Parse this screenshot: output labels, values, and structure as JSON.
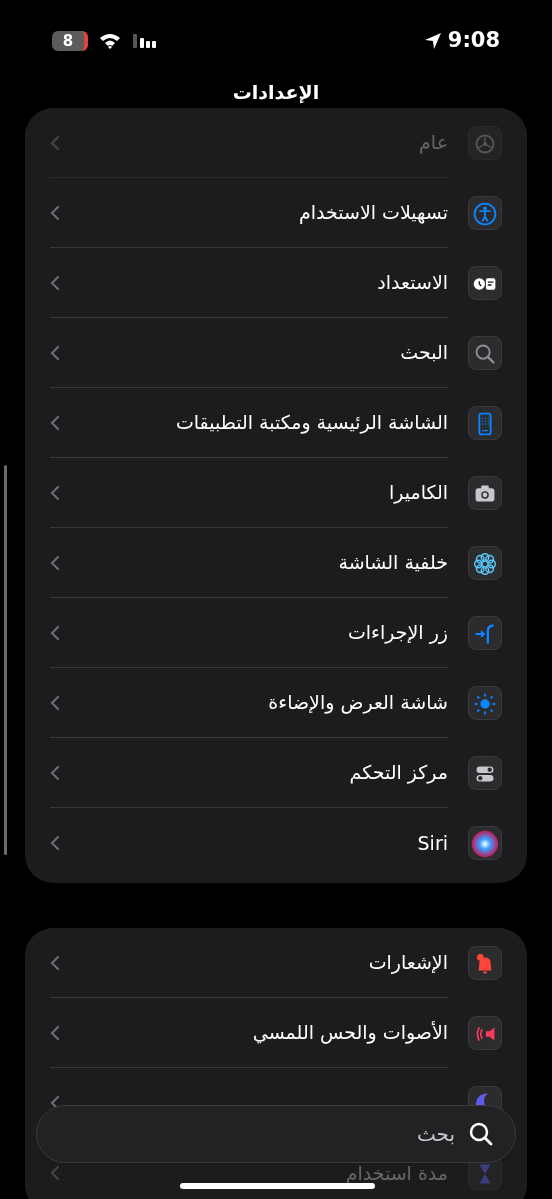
{
  "status_bar": {
    "time": "9:08",
    "battery": "8"
  },
  "title": "الإعدادات",
  "groups": [
    {
      "items": [
        {
          "label": "عام",
          "kind": "gear",
          "faded": true
        },
        {
          "label": "تسهيلات الاستخدام",
          "kind": "accessibility",
          "faded": false
        },
        {
          "label": "الاستعداد",
          "kind": "standby",
          "faded": false
        },
        {
          "label": "البحث",
          "kind": "search",
          "faded": false
        },
        {
          "label": "الشاشة الرئيسية ومكتبة التطبيقات",
          "kind": "homescreen",
          "faded": false
        },
        {
          "label": "الكاميرا",
          "kind": "camera",
          "faded": false
        },
        {
          "label": "خلفية الشاشة",
          "kind": "flower",
          "faded": false
        },
        {
          "label": "زر الإجراءات",
          "kind": "action",
          "faded": false
        },
        {
          "label": "شاشة العرض والإضاءة",
          "kind": "sun",
          "faded": false
        },
        {
          "label": "مركز التحكم",
          "kind": "toggles",
          "faded": false
        },
        {
          "label": "Siri",
          "kind": "siri",
          "faded": false
        }
      ]
    },
    {
      "items": [
        {
          "label": "الإشعارات",
          "kind": "bell",
          "faded": false
        },
        {
          "label": "الأصوات والحس اللمسي",
          "kind": "speaker",
          "faded": false
        },
        {
          "kind": "moon",
          "faded": false
        },
        {
          "label": "مدة استخدام",
          "kind": "hourglass",
          "faded": true
        }
      ]
    }
  ],
  "search": {
    "placeholder": "بحث"
  }
}
